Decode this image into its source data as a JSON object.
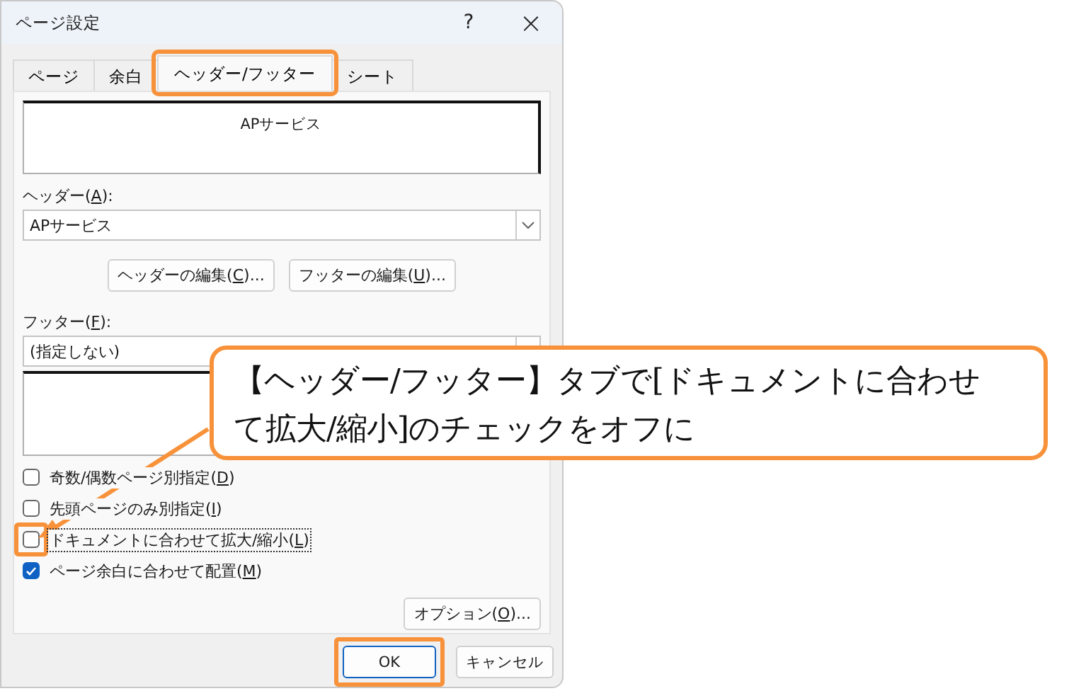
{
  "window": {
    "title": "ページ設定",
    "help": "?",
    "close": "×"
  },
  "tabs": [
    {
      "label": "ページ",
      "selected": false,
      "highlighted": false
    },
    {
      "label": "余白",
      "selected": false,
      "highlighted": false
    },
    {
      "label": "ヘッダー/フッター",
      "selected": true,
      "highlighted": true
    },
    {
      "label": "シート",
      "selected": false,
      "highlighted": false
    }
  ],
  "header_preview": {
    "text": "APサービス"
  },
  "header_field": {
    "label": [
      "ヘッダー(",
      "A",
      "):"
    ],
    "value": "APサービス"
  },
  "edit_buttons": [
    {
      "label": [
        "ヘッダーの編集(",
        "C",
        ")..."
      ]
    },
    {
      "label": [
        "フッターの編集(",
        "U",
        ")..."
      ]
    }
  ],
  "footer_field": {
    "label": [
      "フッター(",
      "F",
      "):"
    ],
    "value": "(指定しない)"
  },
  "checkboxes": [
    {
      "label": [
        "奇数/偶数ページ別指定(",
        "D",
        ")"
      ],
      "checked": false,
      "focused": false,
      "highlighted": false
    },
    {
      "label": [
        "先頭ページのみ別指定(",
        "I",
        ")"
      ],
      "checked": false,
      "focused": false,
      "highlighted": false
    },
    {
      "label": [
        "ドキュメントに合わせて拡大/縮小(",
        "L",
        ")"
      ],
      "checked": false,
      "focused": true,
      "highlighted": true
    },
    {
      "label": [
        "ページ余白に合わせて配置(",
        "M",
        ")"
      ],
      "checked": true,
      "focused": false,
      "highlighted": false
    }
  ],
  "options_button": {
    "label": [
      "オプション(",
      "O",
      ")..."
    ]
  },
  "buttons": [
    {
      "label": "OK",
      "default": true,
      "highlighted": true
    },
    {
      "label": "キャンセル",
      "default": false,
      "highlighted": false
    }
  ],
  "callout": {
    "lines": [
      "【ヘッダー/フッター】タブで[ドキュメントに合わせ",
      "て拡大/縮小]のチェックをオフに"
    ]
  }
}
